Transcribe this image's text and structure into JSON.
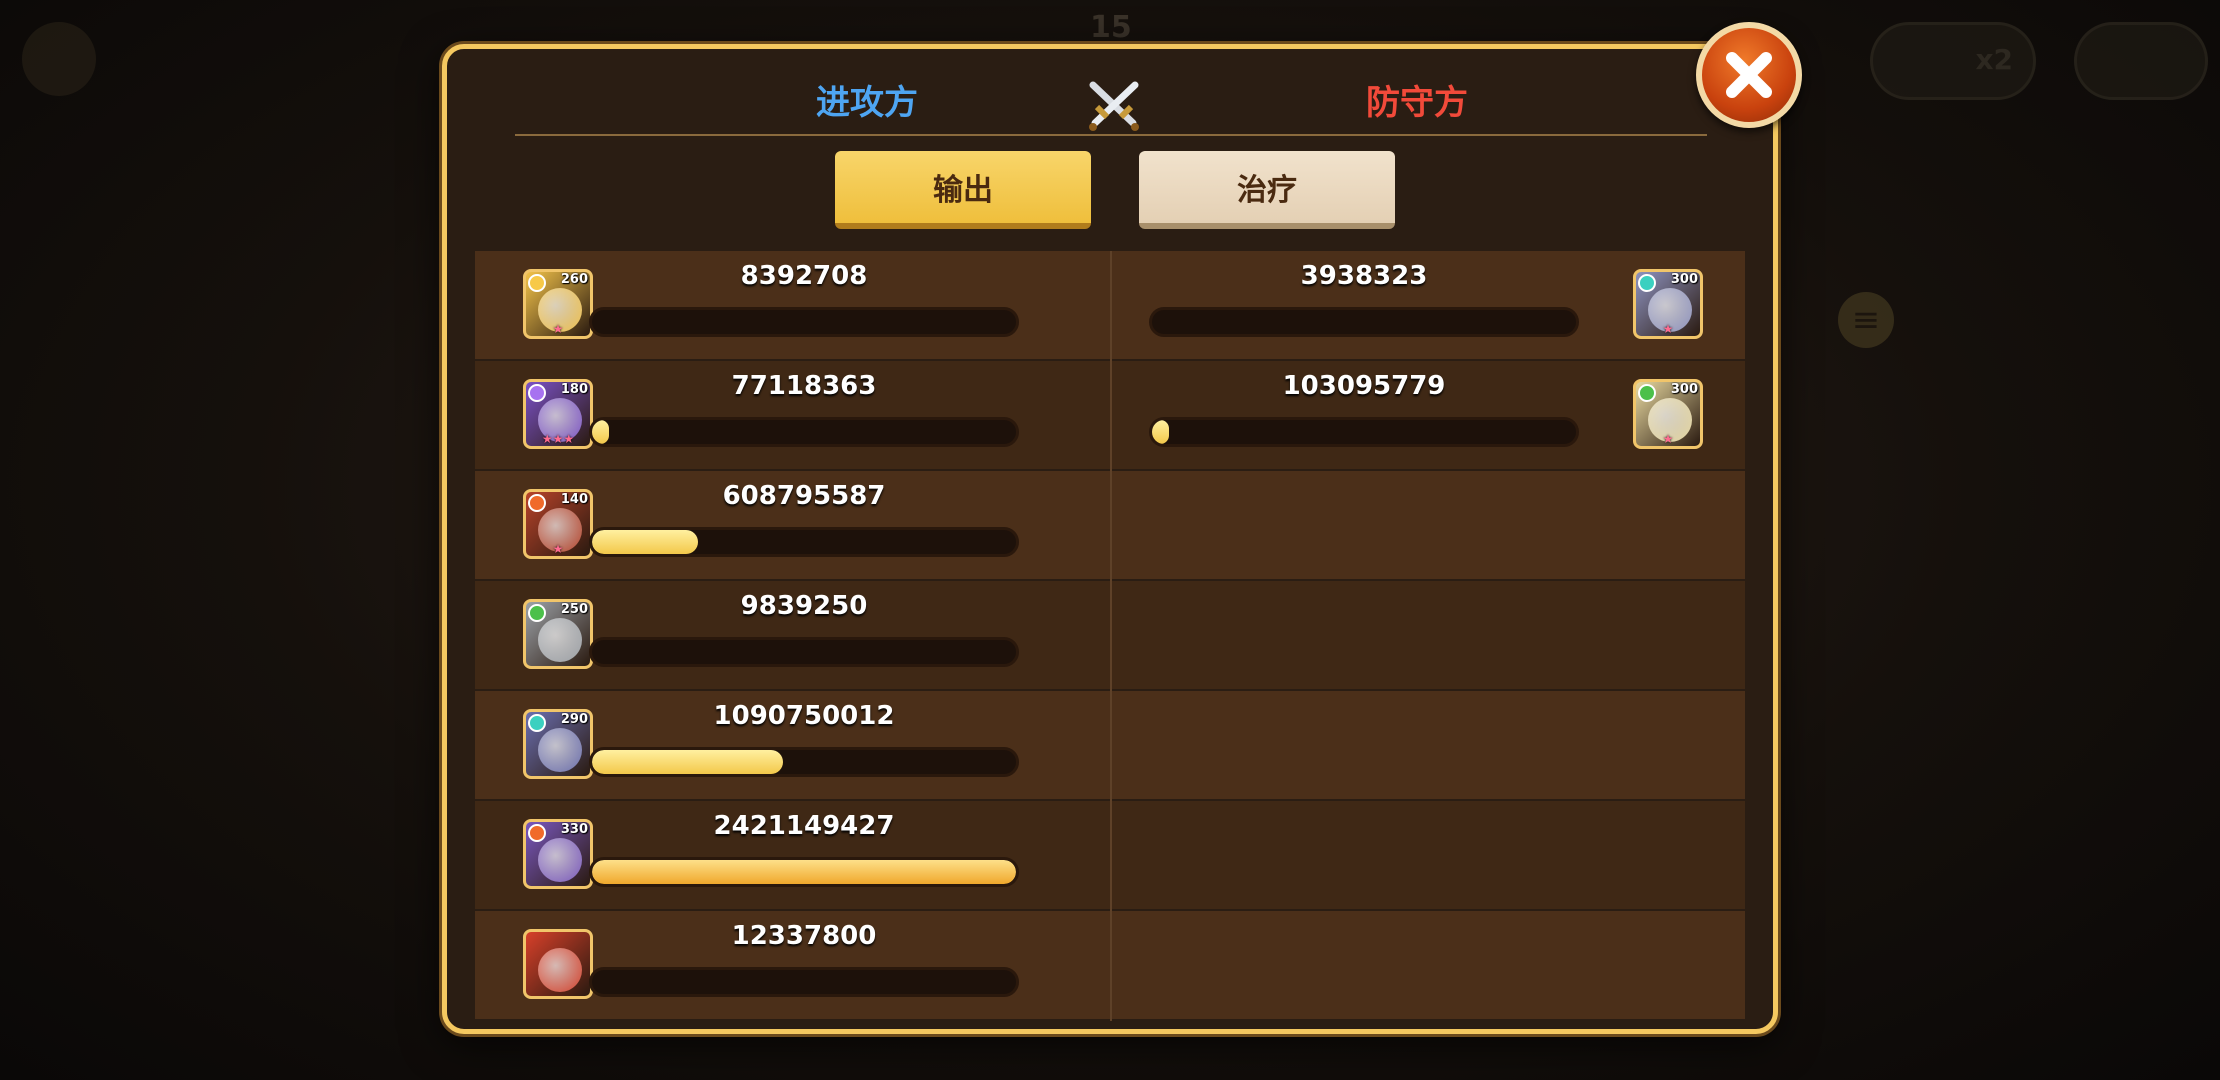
{
  "background": {
    "round_number": "15",
    "speed_label": "x2"
  },
  "dialog": {
    "attacker_title": "进攻方",
    "defender_title": "防守方",
    "tabs": [
      {
        "label": "输出",
        "active": true
      },
      {
        "label": "治疗",
        "active": false
      }
    ],
    "close_icon": "close-icon",
    "attackers": [
      {
        "level": "260",
        "value": "8392708",
        "fill": 0.0,
        "color": "#f3c34a",
        "elem": "#f7c948",
        "stars": "★"
      },
      {
        "level": "180",
        "value": "77118363",
        "fill": 0.03,
        "color": "#7b52c8",
        "elem": "#a772f0",
        "stars": "★★★"
      },
      {
        "level": "140",
        "value": "608795587",
        "fill": 0.25,
        "color": "#b8432a",
        "elem": "#f06a2a",
        "stars": "★"
      },
      {
        "level": "250",
        "value": "9839250",
        "fill": 0.0,
        "color": "#9da2a8",
        "elem": "#4cc04a",
        "stars": ""
      },
      {
        "level": "290",
        "value": "1090750012",
        "fill": 0.45,
        "color": "#6b6fb0",
        "elem": "#3bd0c0",
        "stars": ""
      },
      {
        "level": "330",
        "value": "2421149427",
        "fill": 1.0,
        "color": "#7a58c0",
        "elem": "#f06a2a",
        "stars": ""
      },
      {
        "level": "",
        "value": "12337800",
        "fill": 0.0,
        "color": "#d8402a",
        "elem": "",
        "stars": ""
      }
    ],
    "defenders": [
      {
        "level": "300",
        "value": "3938323",
        "fill": 0.0,
        "color": "#8e93c0",
        "elem": "#3bd0c0",
        "stars": "★"
      },
      {
        "level": "300",
        "value": "103095779",
        "fill": 0.04,
        "color": "#e8d9a0",
        "elem": "#4cc04a",
        "stars": "★"
      }
    ]
  }
}
